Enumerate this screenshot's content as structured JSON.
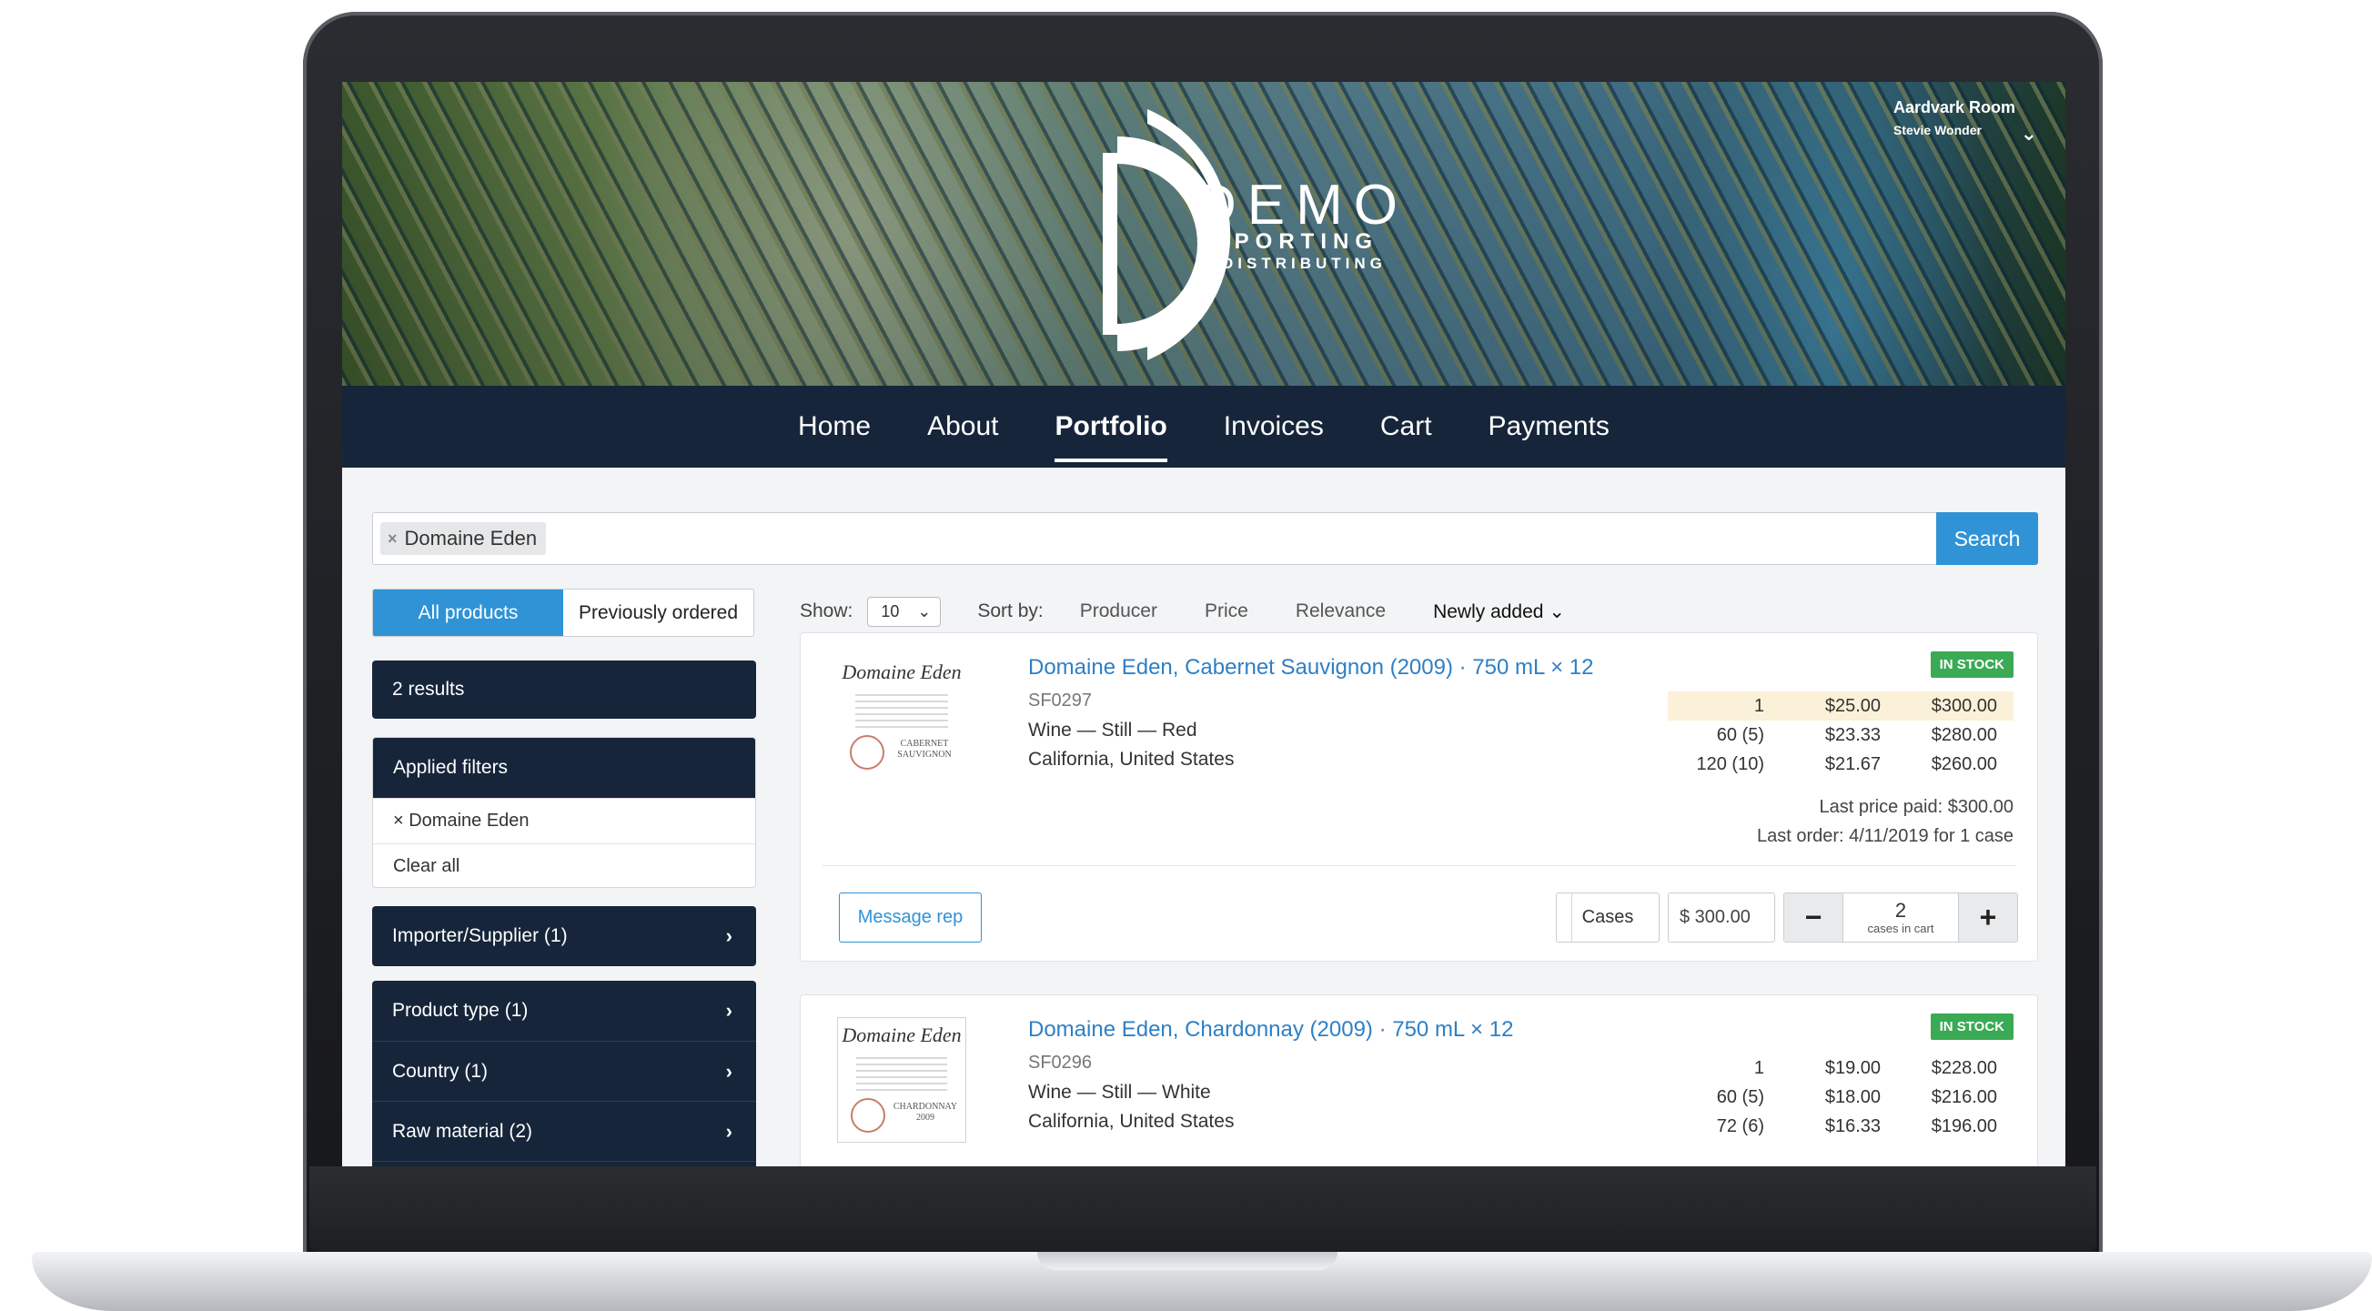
{
  "brand": {
    "logo_main": "DEMO",
    "logo_sub": "IMPORTING",
    "logo_sub2": "& DISTRIBUTING"
  },
  "account": {
    "room": "Aardvark Room",
    "user": "Stevie Wonder"
  },
  "nav": {
    "items": [
      "Home",
      "About",
      "Portfolio",
      "Invoices",
      "Cart",
      "Payments"
    ],
    "active": "Portfolio"
  },
  "search": {
    "chip": "Domaine Eden",
    "button": "Search"
  },
  "sidebar": {
    "toggle": [
      "All products",
      "Previously ordered"
    ],
    "results": "2 results",
    "applied_filters_title": "Applied filters",
    "applied_filter": "× Domaine Eden",
    "clear_all": "Clear all",
    "facets": [
      "Importer/Supplier (1)",
      "Product type (1)",
      "Country (1)",
      "Raw material (2)"
    ]
  },
  "toolbar": {
    "show_label": "Show:",
    "show_value": "10",
    "sort_label": "Sort by:",
    "sort_options": [
      "Producer",
      "Price",
      "Relevance",
      "Newly added"
    ],
    "sort_active": "Newly added"
  },
  "products": [
    {
      "thumb_title": "Domaine Eden",
      "thumb_variety": "CABERNET SAUVIGNON",
      "title": "Domaine Eden, Cabernet Sauvignon (2009) · 750 mL × 12",
      "sku": "SF0297",
      "type": "Wine — Still — Red",
      "origin": "California, United States",
      "badge": "IN STOCK",
      "prices": [
        {
          "qty": "1",
          "unit": "$25.00",
          "total": "$300.00",
          "highlight": true
        },
        {
          "qty": "60 (5)",
          "unit": "$23.33",
          "total": "$280.00",
          "highlight": false
        },
        {
          "qty": "120 (10)",
          "unit": "$21.67",
          "total": "$260.00",
          "highlight": false
        }
      ],
      "last_price": "Last price paid: $300.00",
      "last_order": "Last order: 4/11/2019 for 1 case",
      "message_rep": "Message rep",
      "unit_select": "Cases",
      "price_input": "$ 300.00",
      "stepper_minus": "−",
      "stepper_plus": "+",
      "quantity": "2",
      "quantity_label": "cases in cart"
    },
    {
      "thumb_title": "Domaine Eden",
      "thumb_variety": "CHARDONNAY 2009",
      "title": "Domaine Eden, Chardonnay (2009) · 750 mL × 12",
      "sku": "SF0296",
      "type": "Wine — Still — White",
      "origin": "California, United States",
      "badge": "IN STOCK",
      "prices": [
        {
          "qty": "1",
          "unit": "$19.00",
          "total": "$228.00",
          "highlight": false
        },
        {
          "qty": "60 (5)",
          "unit": "$18.00",
          "total": "$216.00",
          "highlight": false
        },
        {
          "qty": "72 (6)",
          "unit": "$16.33",
          "total": "$196.00",
          "highlight": false
        }
      ]
    }
  ],
  "colors": {
    "nav_bg": "#16253a",
    "accent_blue": "#2f93d6",
    "link_blue": "#2f7fc5",
    "in_stock_green": "#3aaa54",
    "price_highlight": "#fbf1d9"
  }
}
